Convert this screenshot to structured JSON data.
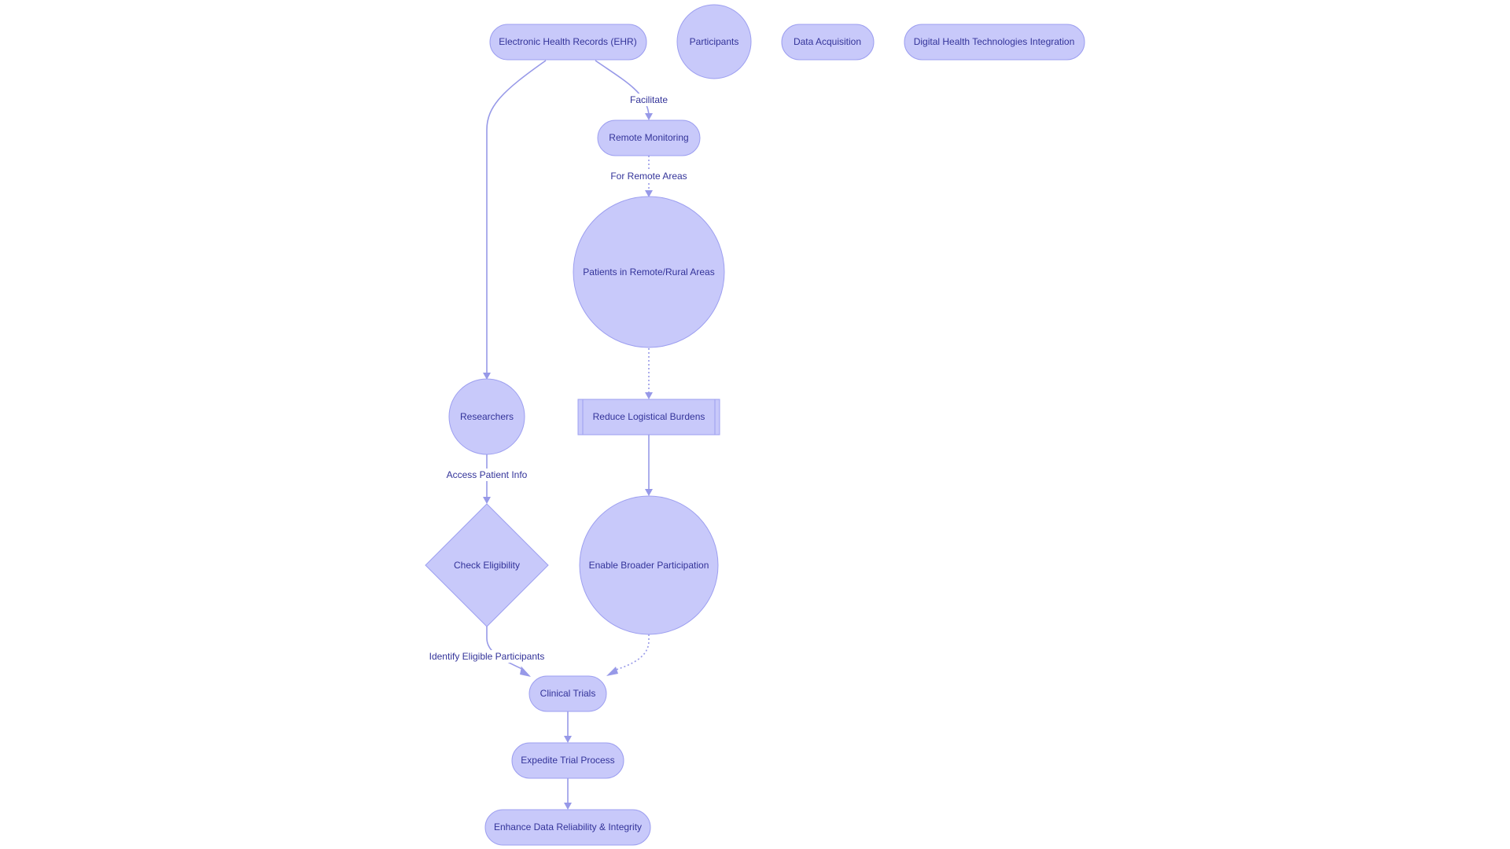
{
  "diagram": {
    "type": "flowchart",
    "colors": {
      "node_fill": "#c8c9fa",
      "node_stroke": "#9d9ff0",
      "edge": "#9799e8",
      "text": "#333399",
      "background": "#ffffff"
    },
    "nodes": {
      "ehr": {
        "label": "Electronic Health Records (EHR)",
        "shape": "stadium"
      },
      "participants": {
        "label": "Participants",
        "shape": "circle"
      },
      "data_acquisition": {
        "label": "Data Acquisition",
        "shape": "stadium"
      },
      "dht_integration": {
        "label": "Digital Health Technologies Integration",
        "shape": "stadium"
      },
      "remote_monitoring": {
        "label": "Remote Monitoring",
        "shape": "stadium"
      },
      "patients_remote": {
        "label": "Patients in Remote/Rural Areas",
        "shape": "circle"
      },
      "researchers": {
        "label": "Researchers",
        "shape": "circle"
      },
      "reduce_burdens": {
        "label": "Reduce Logistical Burdens",
        "shape": "subroutine"
      },
      "check_eligibility": {
        "label": "Check Eligibility",
        "shape": "diamond"
      },
      "broader_participation": {
        "label": "Enable Broader Participation",
        "shape": "circle"
      },
      "clinical_trials": {
        "label": "Clinical Trials",
        "shape": "stadium"
      },
      "expedite": {
        "label": "Expedite Trial Process",
        "shape": "stadium"
      },
      "enhance": {
        "label": "Enhance Data Reliability & Integrity",
        "shape": "stadium"
      }
    },
    "edges": {
      "ehr_researchers": {
        "from": "ehr",
        "to": "researchers",
        "label": "",
        "style": "solid"
      },
      "ehr_remote": {
        "from": "ehr",
        "to": "remote_monitoring",
        "label": "Facilitate",
        "style": "solid"
      },
      "remote_patients": {
        "from": "remote_monitoring",
        "to": "patients_remote",
        "label": "For Remote Areas",
        "style": "dotted"
      },
      "patients_reduce": {
        "from": "patients_remote",
        "to": "reduce_burdens",
        "label": "",
        "style": "dotted"
      },
      "researchers_check": {
        "from": "researchers",
        "to": "check_eligibility",
        "label": "Access Patient Info",
        "style": "solid"
      },
      "reduce_broader": {
        "from": "reduce_burdens",
        "to": "broader_participation",
        "label": "",
        "style": "solid"
      },
      "check_trials": {
        "from": "check_eligibility",
        "to": "clinical_trials",
        "label": "Identify Eligible Participants",
        "style": "solid"
      },
      "broader_trials": {
        "from": "broader_participation",
        "to": "clinical_trials",
        "label": "",
        "style": "dotted"
      },
      "trials_expedite": {
        "from": "clinical_trials",
        "to": "expedite",
        "label": "",
        "style": "solid"
      },
      "expedite_enhance": {
        "from": "expedite",
        "to": "enhance",
        "label": "",
        "style": "solid"
      }
    }
  }
}
